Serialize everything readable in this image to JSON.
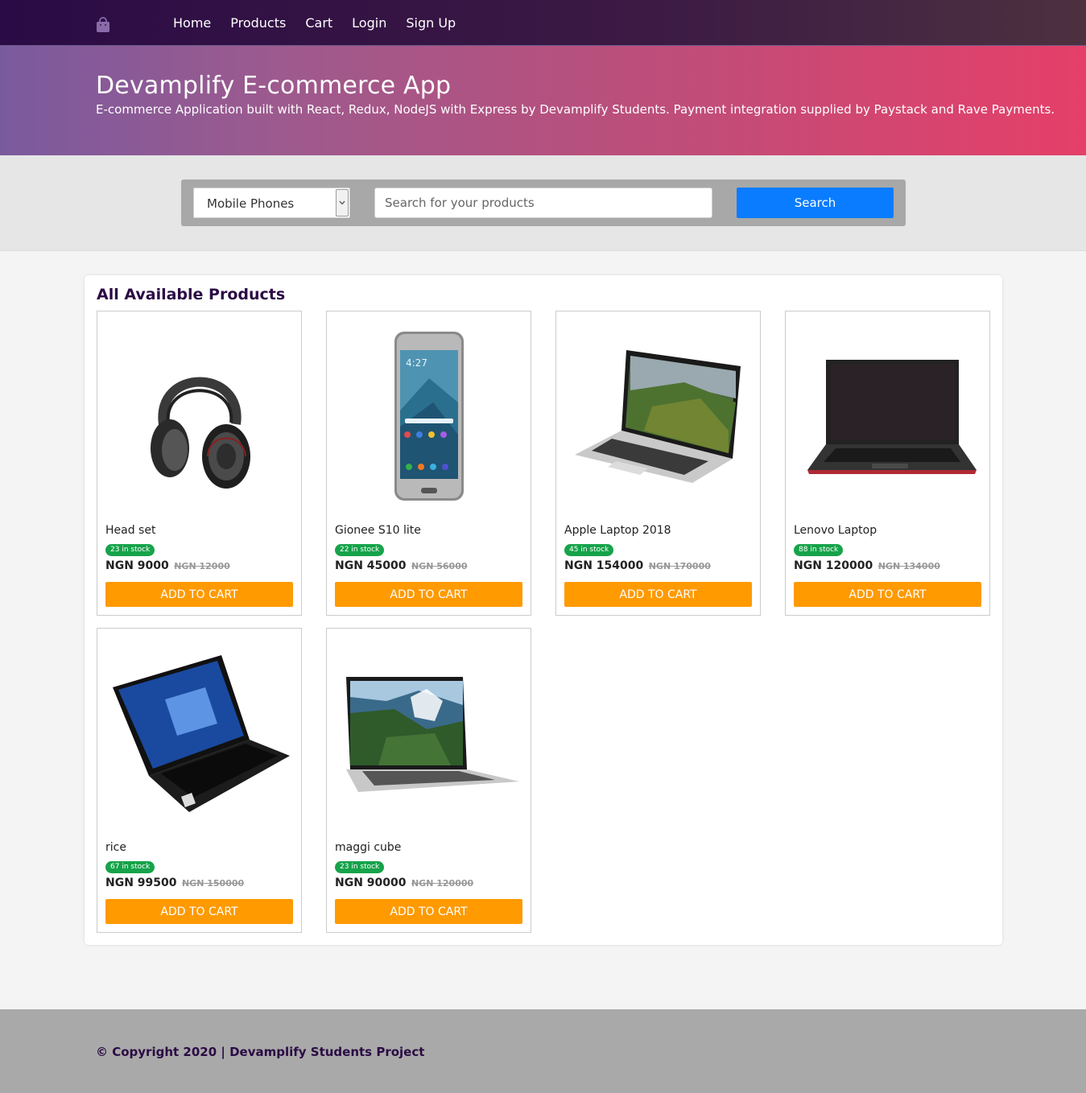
{
  "nav": {
    "logo_icon": "shopping-bag-icon",
    "links": [
      "Home",
      "Products",
      "Cart",
      "Login",
      "Sign Up"
    ]
  },
  "hero": {
    "title": "Devamplify E-commerce App",
    "subtitle": "E-commerce Application built with React, Redux, NodeJS with Express by Devamplify Students. Payment integration supplied by Paystack and Rave Payments."
  },
  "search": {
    "category_selected": "Mobile Phones",
    "placeholder": "Search for your products",
    "value": "",
    "button_label": "Search"
  },
  "products_section": {
    "title": "All Available Products"
  },
  "products": [
    {
      "name": "Head set",
      "stock": "23 in stock",
      "price": "NGN 9000",
      "old_price": "NGN 12000",
      "button": "ADD TO CART",
      "image": "headphones"
    },
    {
      "name": "Gionee S10 lite",
      "stock": "22 in stock",
      "price": "NGN 45000",
      "old_price": "NGN 56000",
      "button": "ADD TO CART",
      "image": "phone"
    },
    {
      "name": "Apple Laptop 2018",
      "stock": "45 in stock",
      "price": "NGN 154000",
      "old_price": "NGN 170000",
      "button": "ADD TO CART",
      "image": "laptop-silver-landscape"
    },
    {
      "name": "Lenovo Laptop",
      "stock": "88 in stock",
      "price": "NGN 120000",
      "old_price": "NGN 134000",
      "button": "ADD TO CART",
      "image": "laptop-black-red"
    },
    {
      "name": "rice",
      "stock": "67 in stock",
      "price": "NGN 99500",
      "old_price": "NGN 150000",
      "button": "ADD TO CART",
      "image": "laptop-windows"
    },
    {
      "name": "maggi cube",
      "stock": "23 in stock",
      "price": "NGN 90000",
      "old_price": "NGN 120000",
      "button": "ADD TO CART",
      "image": "laptop-silver-mountain"
    }
  ],
  "footer": {
    "text": "© Copyright 2020 | Devamplify Students Project"
  },
  "colors": {
    "nav_bg": "#2b0b45",
    "hero_start": "#7a5a9e",
    "hero_end": "#e53f68",
    "search_button": "#0a7cff",
    "cart_button": "#ff9a00",
    "stock_badge": "#16a34a"
  }
}
